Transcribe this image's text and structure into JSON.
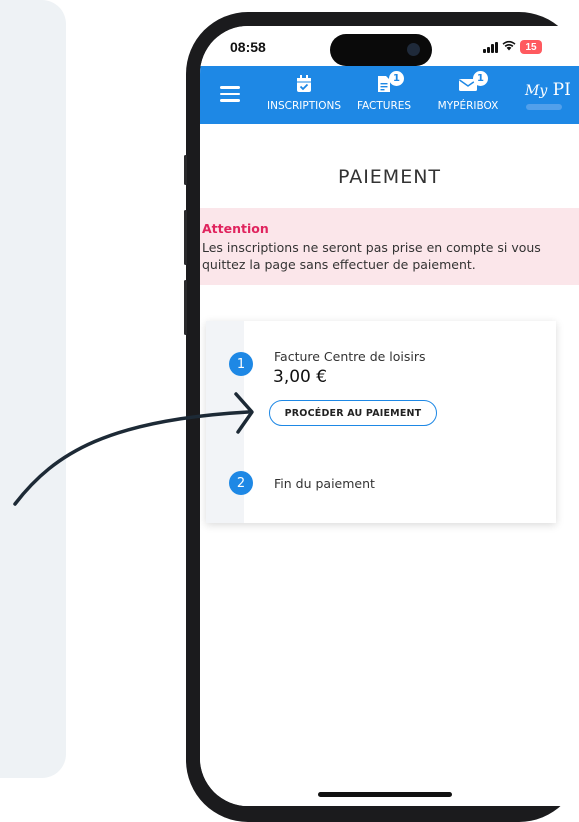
{
  "status_bar": {
    "time": "08:58",
    "battery": "15"
  },
  "nav": {
    "items": [
      {
        "label": "INSCRIPTIONS",
        "icon": "calendar-check-icon",
        "badge": ""
      },
      {
        "label": "FACTURES",
        "icon": "invoice-icon",
        "badge": "1"
      },
      {
        "label": "MYPÉRIBOX",
        "icon": "envelope-icon",
        "badge": "1"
      }
    ],
    "brand_script": "My",
    "brand_text": "PI"
  },
  "page": {
    "title": "PAIEMENT",
    "alert": {
      "title": "Attention",
      "text": "Les inscriptions ne seront pas prise en compte si vous quittez la page sans effectuer de paiement."
    },
    "steps": [
      {
        "number": "1",
        "title": "Facture Centre de loisirs",
        "amount": "3,00 €",
        "button": "PROCÉDER AU PAIEMENT"
      },
      {
        "number": "2",
        "title": "Fin du paiement"
      }
    ]
  },
  "colors": {
    "primary": "#1e88e5",
    "alert_bg": "#fbe6ea",
    "alert_title": "#e0245e",
    "battery": "#ff5a5f"
  }
}
